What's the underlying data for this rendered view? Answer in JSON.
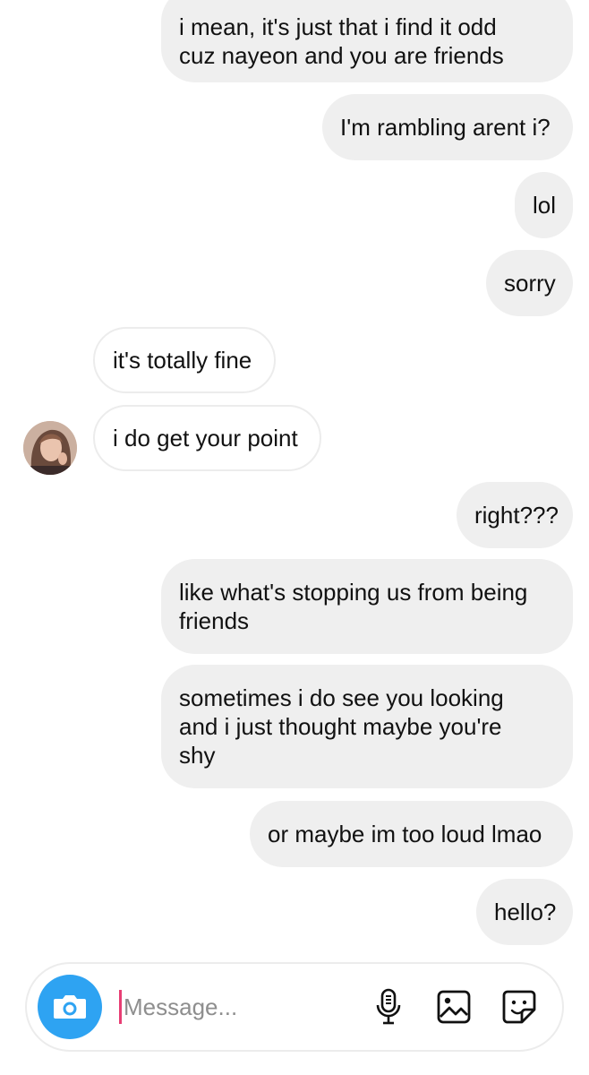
{
  "messages": [
    {
      "direction": "sent",
      "text": "i mean, it's just that i find it odd\ncuz nayeon and you are friends"
    },
    {
      "direction": "sent",
      "text": "I'm rambling arent i?"
    },
    {
      "direction": "sent",
      "text": "lol"
    },
    {
      "direction": "sent",
      "text": "sorry"
    },
    {
      "direction": "received",
      "text": "it's totally fine"
    },
    {
      "direction": "received",
      "text": "i do get your point"
    },
    {
      "direction": "sent",
      "text": "right???"
    },
    {
      "direction": "sent",
      "text": "like what's stopping us from being\nfriends"
    },
    {
      "direction": "sent",
      "text": "sometimes i do see you looking\nand i just thought maybe you're\nshy"
    },
    {
      "direction": "sent",
      "text": "or maybe im too loud lmao"
    },
    {
      "direction": "sent",
      "text": "hello?"
    }
  ],
  "composer": {
    "placeholder": "Message...",
    "value": "",
    "icons": [
      "camera-icon",
      "microphone-icon",
      "gallery-icon",
      "sticker-icon"
    ]
  },
  "colors": {
    "sent_bubble": "#efefef",
    "received_border": "#ececec",
    "camera_button": "#2ea3f2",
    "caret": "#e83e74"
  }
}
